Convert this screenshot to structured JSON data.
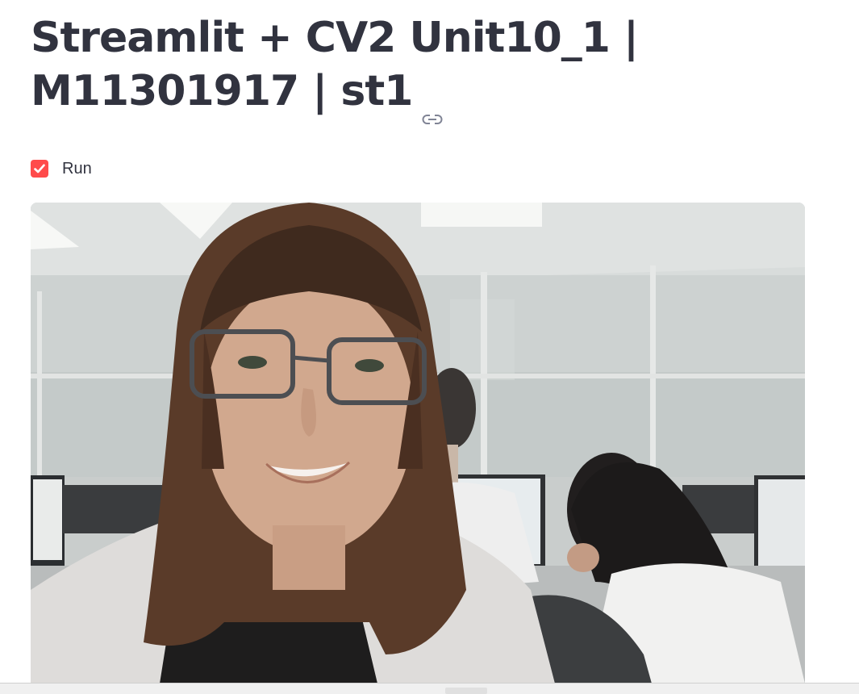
{
  "page": {
    "title": "Streamlit + CV2 Unit10_1 | M11301917 | st1",
    "anchor_icon": "link-icon"
  },
  "run_checkbox": {
    "label": "Run",
    "checked": true,
    "accent_color": "#ff4b4b"
  },
  "video": {
    "icon": "webcam-frame"
  },
  "colors": {
    "text": "#31333f",
    "accent": "#ff4b4b",
    "background": "#ffffff"
  }
}
